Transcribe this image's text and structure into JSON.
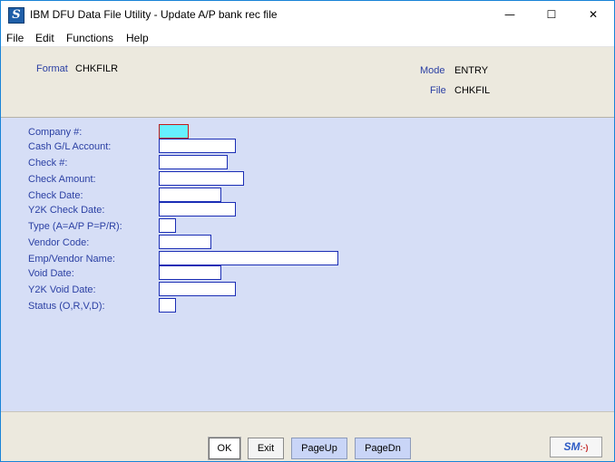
{
  "window": {
    "title": "IBM DFU Data File Utility - Update A/P bank rec file",
    "app_icon": "S",
    "controls": {
      "minimize": "—",
      "maximize": "☐",
      "close": "✕"
    }
  },
  "menu": [
    "File",
    "Edit",
    "Functions",
    "Help"
  ],
  "header": {
    "format_label": "Format",
    "format_value": "CHKFILR",
    "mode_label": "Mode",
    "mode_value": "ENTRY",
    "file_label": "File",
    "file_value": "CHKFIL"
  },
  "fields": [
    {
      "label": "Company #:",
      "value": ""
    },
    {
      "label": "Cash G/L Account:",
      "value": ""
    },
    {
      "label": "Check #:",
      "value": ""
    },
    {
      "label": "Check Amount:",
      "value": ""
    },
    {
      "label": "Check Date:",
      "value": ""
    },
    {
      "label": "Y2K Check Date:",
      "value": ""
    },
    {
      "label": "Type (A=A/P P=P/R):",
      "value": ""
    },
    {
      "label": "Vendor Code:",
      "value": ""
    },
    {
      "label": "Emp/Vendor Name:",
      "value": ""
    },
    {
      "label": "Void Date:",
      "value": ""
    },
    {
      "label": "Y2K Void Date:",
      "value": ""
    },
    {
      "label": "Status (O,R,V,D):",
      "value": ""
    }
  ],
  "buttons": {
    "ok": "OK",
    "exit": "Exit",
    "pageup": "PageUp",
    "pagedn": "PageDn"
  },
  "logo": {
    "text": "SM",
    "face": ":-)"
  },
  "colors": {
    "form_background": "#d6def6",
    "header_background": "#ece9de",
    "active_field": "#66f0ff",
    "label_text": "#2a3fa3"
  }
}
